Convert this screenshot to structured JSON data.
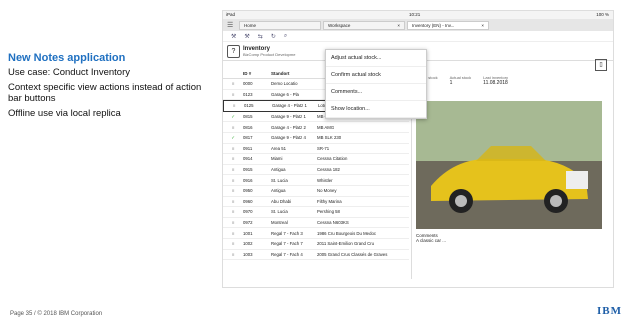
{
  "slide": {
    "title": "New Notes application",
    "bullets": [
      "Use case: Conduct Inventory",
      "Context specific view actions instead of action bar buttons",
      "Offline use via local replica"
    ],
    "footer": "Page 35 / © 2018 IBM Corporation",
    "logo": "IBM"
  },
  "device": {
    "carrier": "iPad",
    "time": "10:21",
    "battery": "100 %"
  },
  "tabs": [
    {
      "label": "Home"
    },
    {
      "label": "Workspace"
    },
    {
      "label": "Inventory (EN) - Inv..."
    }
  ],
  "app": {
    "title": "Inventory",
    "subtitle": "BizComp Product Developme"
  },
  "list": {
    "headers": [
      "ID #",
      "Standort"
    ],
    "rows": [
      {
        "id": "0000",
        "loc": "Demo Locatio",
        "name": "",
        "mark": "≡"
      },
      {
        "id": "0123",
        "loc": "Garage 6 - Pla",
        "name": "",
        "mark": "≡"
      },
      {
        "id": "0125",
        "loc": "Garage 4 - Platz 1",
        "name": "Lotus Elan",
        "mark": "≡"
      },
      {
        "id": "0815",
        "loc": "Garage 9 - Platz 1",
        "name": "MB CLK 200",
        "mark": "✓"
      },
      {
        "id": "0816",
        "loc": "Garage 4 - Platz 2",
        "name": "MB AMG",
        "mark": "≡"
      },
      {
        "id": "0817",
        "loc": "Garage 9 - Platz 4",
        "name": "MB SLK 230",
        "mark": "✓"
      },
      {
        "id": "0911",
        "loc": "Area 51",
        "name": "SR-71",
        "mark": "≡"
      },
      {
        "id": "0914",
        "loc": "Miami",
        "name": "Cessna Citation",
        "mark": "≡"
      },
      {
        "id": "0915",
        "loc": "Antigua",
        "name": "Cessna 182",
        "mark": "≡"
      },
      {
        "id": "0916",
        "loc": "St. Lucia",
        "name": "Whistler",
        "mark": "≡"
      },
      {
        "id": "0950",
        "loc": "Antigua",
        "name": "No Money",
        "mark": "≡"
      },
      {
        "id": "0960",
        "loc": "Abu Dhabi",
        "name": "Filthy Marina",
        "mark": "≡"
      },
      {
        "id": "0970",
        "loc": "St. Lucia",
        "name": "Pershing 58",
        "mark": "≡"
      },
      {
        "id": "0972",
        "loc": "Montreal",
        "name": "Cessna N603KS",
        "mark": "≡"
      },
      {
        "id": "1001",
        "loc": "Regal 7 - Fach 3",
        "name": "1986 Cru Bourgeois Du Medoc",
        "mark": "≡"
      },
      {
        "id": "1002",
        "loc": "Regal 7 - Fach 7",
        "name": "2011 Saint-Emilion Grand Cru",
        "mark": "≡"
      },
      {
        "id": "1003",
        "loc": "Regal 7 - Fach 4",
        "name": "2005 Grand Crus Classés de Graves",
        "mark": "≡"
      }
    ]
  },
  "popup": {
    "items": [
      "Adjust actual stock...",
      "Confirm actual stock",
      "Comments...",
      "Show location..."
    ]
  },
  "detail": {
    "target_label": "Target stock",
    "target_value": "1",
    "actual_label": "Actual stock",
    "actual_value": "1",
    "inventory_label": "Last inventory",
    "inventory_value": "11.08.2018",
    "comments_label": "Comments",
    "comments_value": "A classic car ..."
  }
}
